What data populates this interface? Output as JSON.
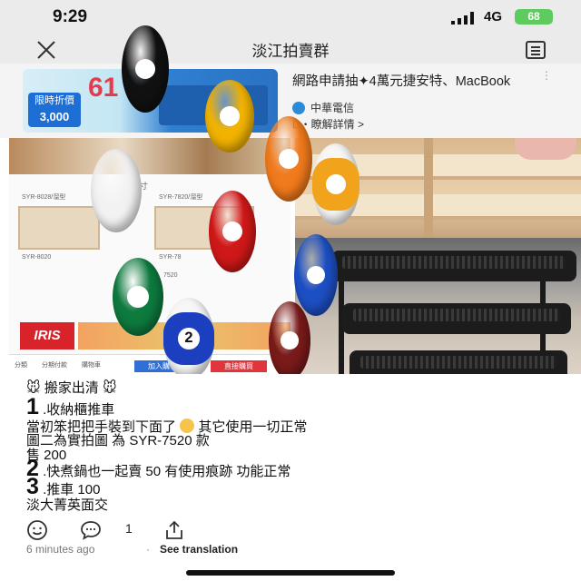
{
  "status": {
    "time": "9:29",
    "network": "4G",
    "battery": "68"
  },
  "nav": {
    "title": "淡江拍賣群"
  },
  "ad": {
    "title": "網路申請抽✦4萬元捷安特、MacBook",
    "brand": "中華電信",
    "cta": "D・瞭解詳情 >",
    "badge_top": "限時折價",
    "badge_price": "3,000",
    "big_text": "61"
  },
  "photo": {
    "spec_title": "尺寸",
    "model_a": "SYR-8028/溜型",
    "model_b": "SYR-7820/溜型",
    "model_c": "SYR-8020",
    "model_d": "SYR-78",
    "model_e": "7520",
    "brand_logo": "IRIS",
    "labels": [
      "分類",
      "分期付款",
      "購物車"
    ],
    "add_cart": "加入購物",
    "buy_now": "直接購買"
  },
  "balls": [
    {
      "number": "",
      "color": "#111111",
      "kind": "solid"
    },
    {
      "number": "",
      "color": "#f2b300",
      "kind": "solid"
    },
    {
      "number": "",
      "color": "#f07a1c",
      "kind": "solid"
    },
    {
      "number": "",
      "color": "#f2f2f2",
      "kind": "solid"
    },
    {
      "number": "",
      "color": "#f2a31c",
      "kind": "stripe"
    },
    {
      "number": "",
      "color": "#d01818",
      "kind": "solid"
    },
    {
      "number": "",
      "color": "#1d4fc4",
      "kind": "solid"
    },
    {
      "number": "",
      "color": "#0d7a3e",
      "kind": "solid"
    },
    {
      "number": "2",
      "color": "#1c3fbf",
      "kind": "stripe"
    },
    {
      "number": "",
      "color": "#7a1a1a",
      "kind": "solid"
    }
  ],
  "post": {
    "heading": "搬家出清",
    "item1_num": "1",
    "item1_title": ".收納櫃推車",
    "line2a": "當初笨把把手裝到下面了",
    "line2b": "其它使用一切正常",
    "line3": "圖二為實拍圖 為 SYR-7520 款",
    "line4": "售 200",
    "item2_num": "2",
    "item2_text": ".快煮鍋也一起賣 50 有使用痕跡 功能正常",
    "item3_num": "3",
    "item3_text": ".推車 100",
    "line8": "淡大菁英面交"
  },
  "actions": {
    "reply_count": "1"
  },
  "meta": {
    "time": "6 minutes ago",
    "dot": "·",
    "see_translation": "See translation"
  }
}
